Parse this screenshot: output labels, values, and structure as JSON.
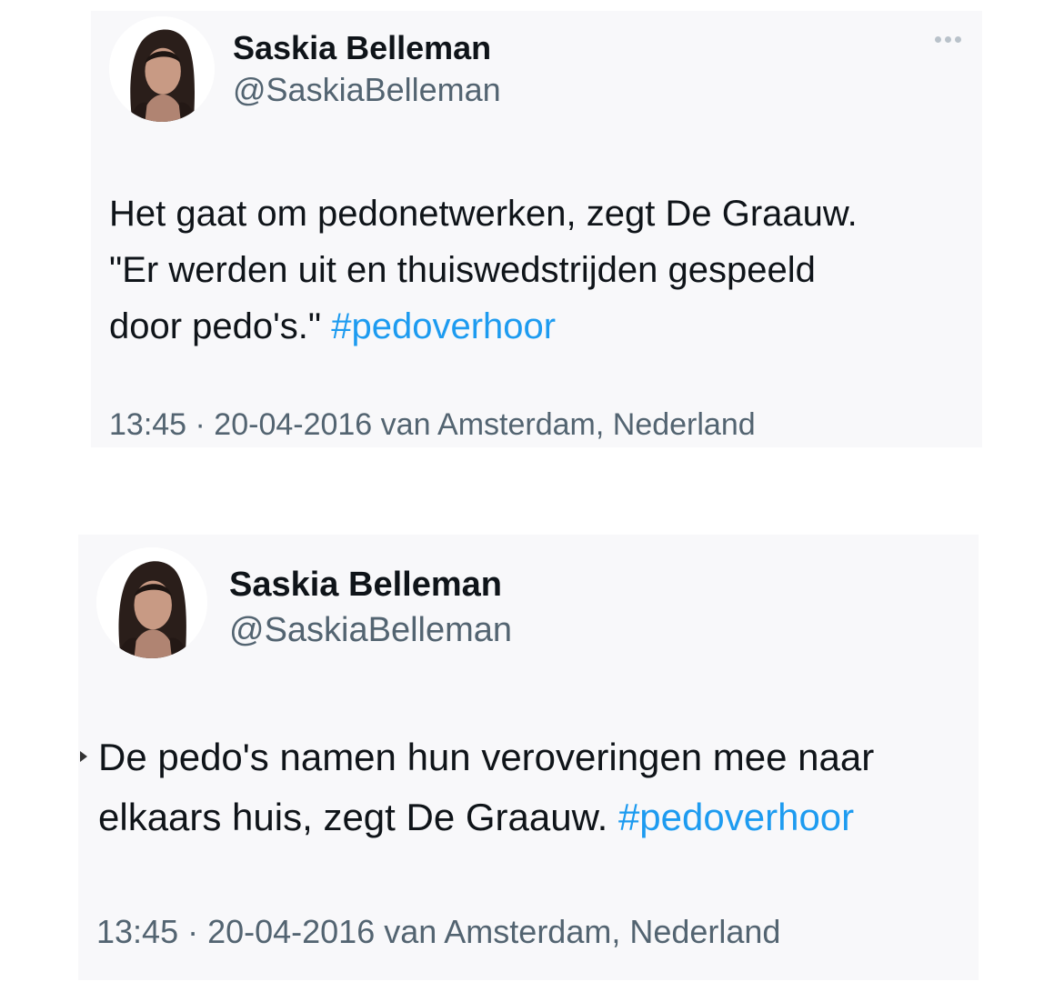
{
  "tweets": [
    {
      "author_name": "Saskia Belleman",
      "author_handle": "@SaskiaBelleman",
      "more_icon": "more-horizontal-icon",
      "text_lines": [
        "Het gaat om pedonetwerken, zegt De Graauw.",
        "\"Er werden uit en thuiswedstrijden gespeeld",
        "door pedo's.\" "
      ],
      "hashtag": "#pedoverhoor",
      "timestamp": "13:45 · 20-04-2016 van Amsterdam, Nederland"
    },
    {
      "author_name": "Saskia Belleman",
      "author_handle": "@SaskiaBelleman",
      "text_lines": [
        "De pedo's namen hun veroveringen mee naar",
        "elkaars huis, zegt De Graauw. "
      ],
      "hashtag": "#pedoverhoor",
      "timestamp": "13:45 · 20-04-2016 van Amsterdam, Nederland"
    }
  ],
  "colors": {
    "hashtag": "#1d9bf0",
    "name": "#0f1419",
    "secondary": "#536471",
    "card_background": "#f8f8fa"
  }
}
